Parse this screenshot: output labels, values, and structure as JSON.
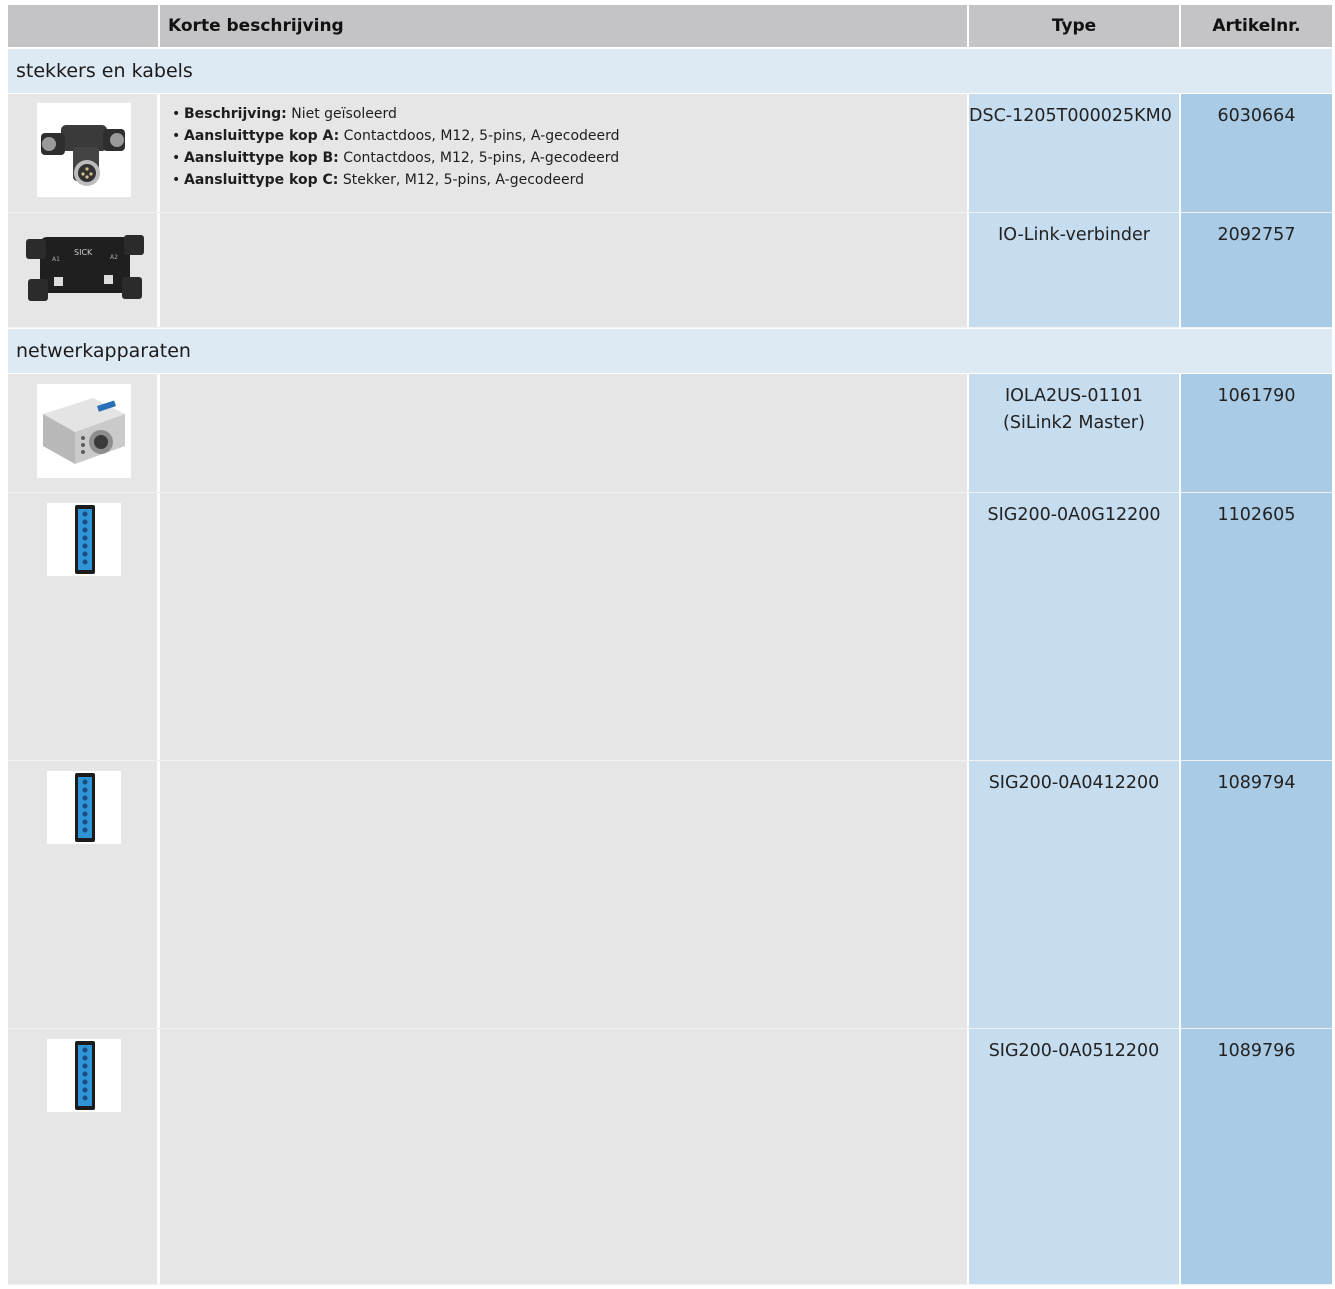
{
  "header": {
    "description_label": "Korte beschrijving",
    "type_label": "Type",
    "article_label": "Artikelnr."
  },
  "sections": [
    {
      "title": "stekkers en kabels",
      "rows": [
        {
          "image": "t-connector-m12-icon",
          "description": [
            {
              "label": "Beschrijving:",
              "value": "Niet geïsoleerd"
            },
            {
              "label": "Aansluittype kop A:",
              "value": "Contactdoos, M12, 5-pins, A-gecodeerd"
            },
            {
              "label": "Aansluittype kop B:",
              "value": "Contactdoos, M12, 5-pins, A-gecodeerd"
            },
            {
              "label": "Aansluittype kop C:",
              "value": "Stekker, M12, 5-pins, A-gecodeerd"
            }
          ],
          "type": "DSC-1205T000025KM0",
          "article": "6030664"
        },
        {
          "image": "io-link-connector-icon",
          "description": [],
          "type": "IO-Link-verbinder",
          "article": "2092757"
        }
      ]
    },
    {
      "title": "netwerkapparaten",
      "rows": [
        {
          "image": "silink2-master-icon",
          "description": [],
          "type": "IOLA2US-01101",
          "type_line2": "(SiLink2 Master)",
          "article": "1061790"
        },
        {
          "image": "sig200-module-icon",
          "description": [],
          "type": "SIG200-0A0G12200",
          "article": "1102605"
        },
        {
          "image": "sig200-module-icon",
          "description": [],
          "type": "SIG200-0A0412200",
          "article": "1089794"
        },
        {
          "image": "sig200-module-icon",
          "description": [],
          "type": "SIG200-0A0512200",
          "article": "1089796"
        }
      ]
    }
  ]
}
